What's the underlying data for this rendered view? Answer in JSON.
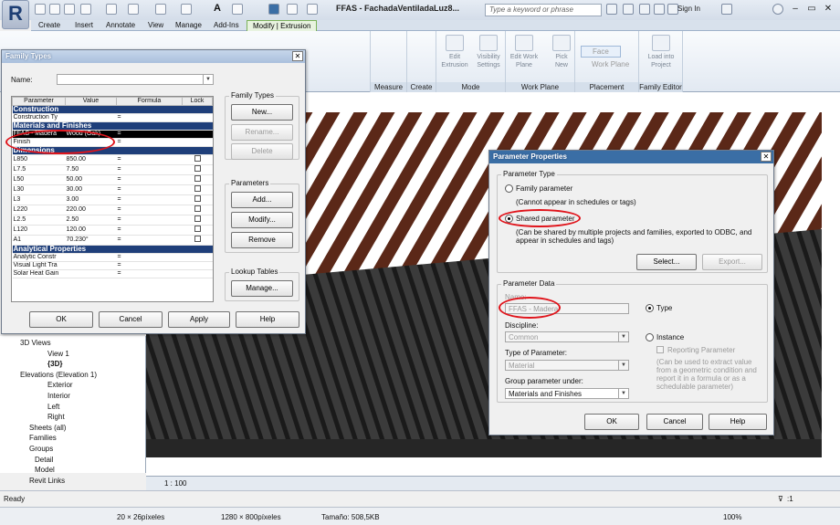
{
  "app": {
    "doc_title": "FFAS - FachadaVentiladaLuz8...",
    "search_placeholder": "Type a keyword or phrase",
    "sign_in": "Sign In"
  },
  "tabs": [
    "Create",
    "Insert",
    "Annotate",
    "View",
    "Manage",
    "Add-Ins",
    "Modify | Extrusion"
  ],
  "ribbon": {
    "panels": [
      "Measure",
      "Create",
      "Mode",
      "Work Plane",
      "Placement",
      "Family Editor"
    ],
    "buttons": [
      {
        "label": "Edit Extrusion"
      },
      {
        "label": "Visibility Settings"
      },
      {
        "label": "Edit Work Plane"
      },
      {
        "label": "Pick New"
      },
      {
        "label": "Face"
      },
      {
        "label": "Work Plane"
      },
      {
        "label": "Load into Project"
      }
    ]
  },
  "family_types": {
    "title": "Family Types",
    "name_label": "Name:",
    "headers": [
      "Parameter",
      "Value",
      "Formula",
      "Lock"
    ],
    "sections": [
      {
        "title": "Construction",
        "rows": [
          [
            "Construction Ty",
            "",
            "="
          ]
        ]
      },
      {
        "title": "Materials and Finishes",
        "rows": [
          [
            "FFAS - Madera",
            "Wood (Oak)",
            "="
          ],
          [
            "Finish",
            "",
            "="
          ]
        ]
      },
      {
        "title": "Dimensions",
        "rows": [
          [
            "L850",
            "850.00",
            "="
          ],
          [
            "L7.5",
            "7.50",
            "="
          ],
          [
            "L50",
            "50.00",
            "="
          ],
          [
            "L30",
            "30.00",
            "="
          ],
          [
            "L3",
            "3.00",
            "="
          ],
          [
            "L220",
            "220.00",
            "="
          ],
          [
            "L2.5",
            "2.50",
            "="
          ],
          [
            "L120",
            "120.00",
            "="
          ],
          [
            "A1",
            "70.230°",
            "="
          ]
        ]
      },
      {
        "title": "Analytical Properties",
        "rows": [
          [
            "Analytic Constr",
            "",
            "="
          ],
          [
            "Visual Light Tra",
            "",
            "="
          ],
          [
            "Solar Heat Gain",
            "",
            "="
          ]
        ]
      }
    ],
    "group_family_types": "Family Types",
    "btn_new": "New...",
    "btn_rename": "Rename...",
    "btn_delete": "Delete",
    "group_parameters": "Parameters",
    "btn_add": "Add...",
    "btn_modify": "Modify...",
    "btn_remove": "Remove",
    "group_lookup": "Lookup Tables",
    "btn_manage": "Manage...",
    "btn_ok": "OK",
    "btn_cancel": "Cancel",
    "btn_apply": "Apply",
    "btn_help": "Help"
  },
  "param_props": {
    "title": "Parameter Properties",
    "group_type": "Parameter Type",
    "family_param": "Family parameter",
    "family_note": "(Cannot appear in schedules or tags)",
    "shared_param": "Shared parameter",
    "shared_note": "(Can be shared by multiple projects and families, exported to ODBC, and appear in schedules and tags)",
    "btn_select": "Select...",
    "btn_export": "Export...",
    "group_data": "Parameter Data",
    "name_label": "Name:",
    "name_value": "FFAS - Madera",
    "discipline_label": "Discipline:",
    "discipline_value": "Common",
    "type_of_param_label": "Type of Parameter:",
    "type_of_param_value": "Material",
    "group_under_label": "Group parameter under:",
    "group_under_value": "Materials and Finishes",
    "radio_type": "Type",
    "radio_instance": "Instance",
    "reporting": "Reporting Parameter",
    "reporting_note": "(Can be used to extract value from a geometric condition and report it in a formula or as a schedulable parameter)",
    "btn_ok": "OK",
    "btn_cancel": "Cancel",
    "btn_help": "Help"
  },
  "browser": {
    "items": [
      {
        "text": "3D Views",
        "indent": 22
      },
      {
        "text": "View 1",
        "indent": 52
      },
      {
        "text": "{3D}",
        "indent": 52
      },
      {
        "text": "Elevations (Elevation 1)",
        "indent": 22
      },
      {
        "text": "Exterior",
        "indent": 52
      },
      {
        "text": "Interior",
        "indent": 52
      },
      {
        "text": "Left",
        "indent": 52
      },
      {
        "text": "Right",
        "indent": 52
      },
      {
        "text": "Sheets (all)",
        "indent": 32
      },
      {
        "text": "Families",
        "indent": 32
      },
      {
        "text": "Groups",
        "indent": 32
      },
      {
        "text": "Detail",
        "indent": 38
      },
      {
        "text": "Model",
        "indent": 38
      },
      {
        "text": "Revit Links",
        "indent": 32
      }
    ]
  },
  "viewbar": {
    "scale": "1 : 100"
  },
  "status": {
    "text": "Ready",
    "filter": ":1"
  },
  "taskbar": {
    "size": "20 × 26píxeles",
    "resolution": "1280 × 800píxeles",
    "filesize": "Tamaño: 508,5KB",
    "zoom": "100%"
  },
  "colors": {
    "accent": "#1f3f7a",
    "highlight": "#e0141b",
    "title_blue": "#3a6ea5",
    "beam": "#5b2818"
  }
}
